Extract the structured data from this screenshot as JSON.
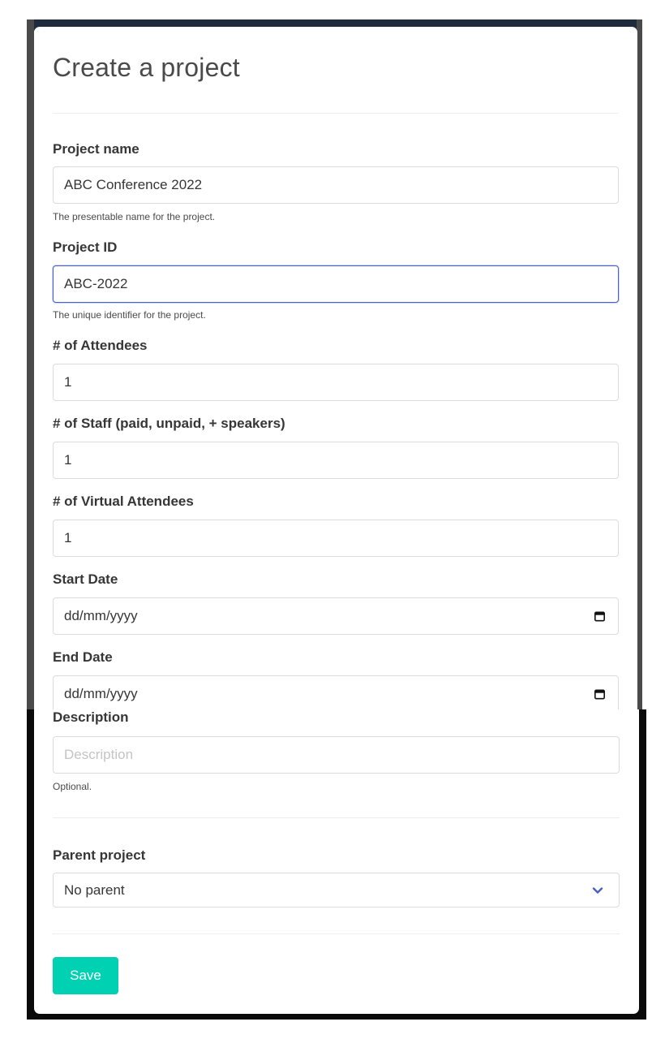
{
  "modal": {
    "title": "Create a project"
  },
  "form": {
    "project_name": {
      "label": "Project name",
      "value": "ABC Conference 2022",
      "help": "The presentable name for the project."
    },
    "project_id": {
      "label": "Project ID",
      "value": "ABC-2022",
      "help": "The unique identifier for the project."
    },
    "attendees": {
      "label": "# of Attendees",
      "value": "1"
    },
    "staff": {
      "label": "# of Staff (paid, unpaid, + speakers)",
      "value": "1"
    },
    "virtual_attendees": {
      "label": "# of Virtual Attendees",
      "value": "1"
    },
    "start_date": {
      "label": "Start Date",
      "value": "dd/mm/yyyy",
      "icon": "calendar-icon"
    },
    "end_date": {
      "label": "End Date",
      "value": "dd/mm/yyyy",
      "icon": "calendar-icon"
    },
    "description": {
      "label": "Description",
      "placeholder": "Description",
      "help": "Optional."
    },
    "parent_project": {
      "label": "Parent project",
      "selected": "No parent",
      "icon": "chevron-down-icon"
    },
    "save_label": "Save"
  },
  "colors": {
    "primary_button": "#00d1b2",
    "focus_border": "#485fc7",
    "chevron": "#485fc7",
    "backdrop": "#0a0a0a"
  }
}
